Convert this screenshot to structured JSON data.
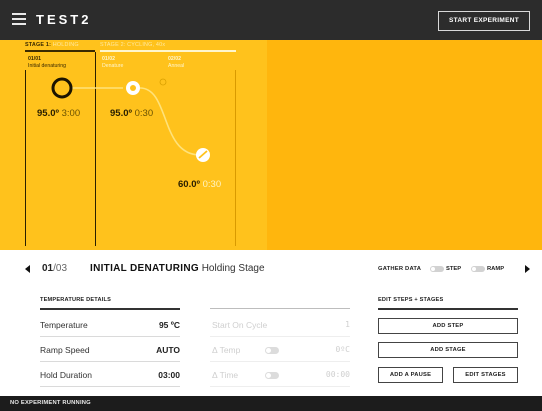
{
  "app": {
    "title": "TEST2",
    "start_label": "START EXPERIMENT"
  },
  "colors": {
    "accent": "#ffc21c",
    "accent_dark": "#ffb60d",
    "topbar": "#2c2c2c",
    "footer": "#1c1c1c"
  },
  "stages": [
    {
      "label": "STAGE 1:",
      "name": "HOLDING"
    },
    {
      "label": "STAGE 2:",
      "name": "CYCLING, 40x"
    }
  ],
  "steps": [
    {
      "num": "01/01",
      "name": "Initial denaturing",
      "temp": "95.0º",
      "duration": "3:00"
    },
    {
      "num": "01/02",
      "name": "Denature",
      "temp": "95.0º",
      "duration": "0:30"
    },
    {
      "num": "02/02",
      "name": "Anneal",
      "temp": "60.0º",
      "duration": "0:30"
    }
  ],
  "step_nav": {
    "current": "01",
    "total": "/03",
    "step_name": "INITIAL DENATURING",
    "stage_name": "Holding Stage",
    "gather_label": "GATHER DATA",
    "step_toggle": "STEP",
    "ramp_toggle": "RAMP"
  },
  "temp_details": {
    "title": "TEMPERATURE DETAILS",
    "rows": [
      {
        "label": "Temperature",
        "value": "95 ºC"
      },
      {
        "label": "Ramp Speed",
        "value": "AUTO"
      },
      {
        "label": "Hold Duration",
        "value": "03:00"
      }
    ]
  },
  "cycle_details": {
    "rows": [
      {
        "label": "Start On Cycle",
        "value": "1"
      },
      {
        "label": "Δ Temp",
        "value": "0ºC"
      },
      {
        "label": "Δ Time",
        "value": "00:00"
      }
    ]
  },
  "edit_panel": {
    "title": "EDIT STEPS + STAGES",
    "add_step": "ADD STEP",
    "add_stage": "ADD STAGE",
    "add_pause": "ADD A PAUSE",
    "edit_stages": "EDIT STAGES"
  },
  "footer": {
    "status": "NO EXPERIMENT RUNNING"
  }
}
